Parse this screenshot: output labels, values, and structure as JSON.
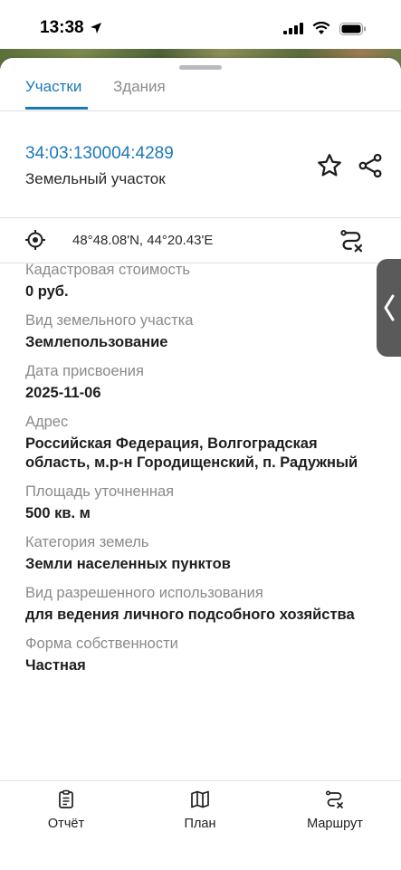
{
  "status_bar": {
    "time": "13:38"
  },
  "tabs": [
    {
      "label": "Участки",
      "active": true
    },
    {
      "label": "Здания",
      "active": false
    }
  ],
  "parcel": {
    "cadastral_number": "34:03:130004:4289",
    "type": "Земельный участок"
  },
  "coordinates": {
    "text": "48°48.08'N, 44°20.43'E"
  },
  "fields": [
    {
      "label": "Кадастровая стоимость",
      "value": "0 руб."
    },
    {
      "label": "Вид земельного участка",
      "value": "Землепользование"
    },
    {
      "label": "Дата присвоения",
      "value": "2025-11-06"
    },
    {
      "label": "Адрес",
      "value": "Российская Федерация, Волгоградская область, м.р-н Городищенский, п. Радужный"
    },
    {
      "label": "Площадь уточненная",
      "value": "500 кв. м"
    },
    {
      "label": "Категория земель",
      "value": "Земли населенных пунктов"
    },
    {
      "label": "Вид разрешенного использования",
      "value": "для ведения личного подсобного хозяйства"
    },
    {
      "label": "Форма собственности",
      "value": "Частная"
    }
  ],
  "bottom_nav": [
    {
      "label": "Отчёт",
      "icon": "report-icon"
    },
    {
      "label": "План",
      "icon": "map-icon"
    },
    {
      "label": "Маршрут",
      "icon": "route-icon"
    }
  ],
  "colors": {
    "accent": "#1c78b5",
    "label_gray": "#8a8a8a"
  }
}
